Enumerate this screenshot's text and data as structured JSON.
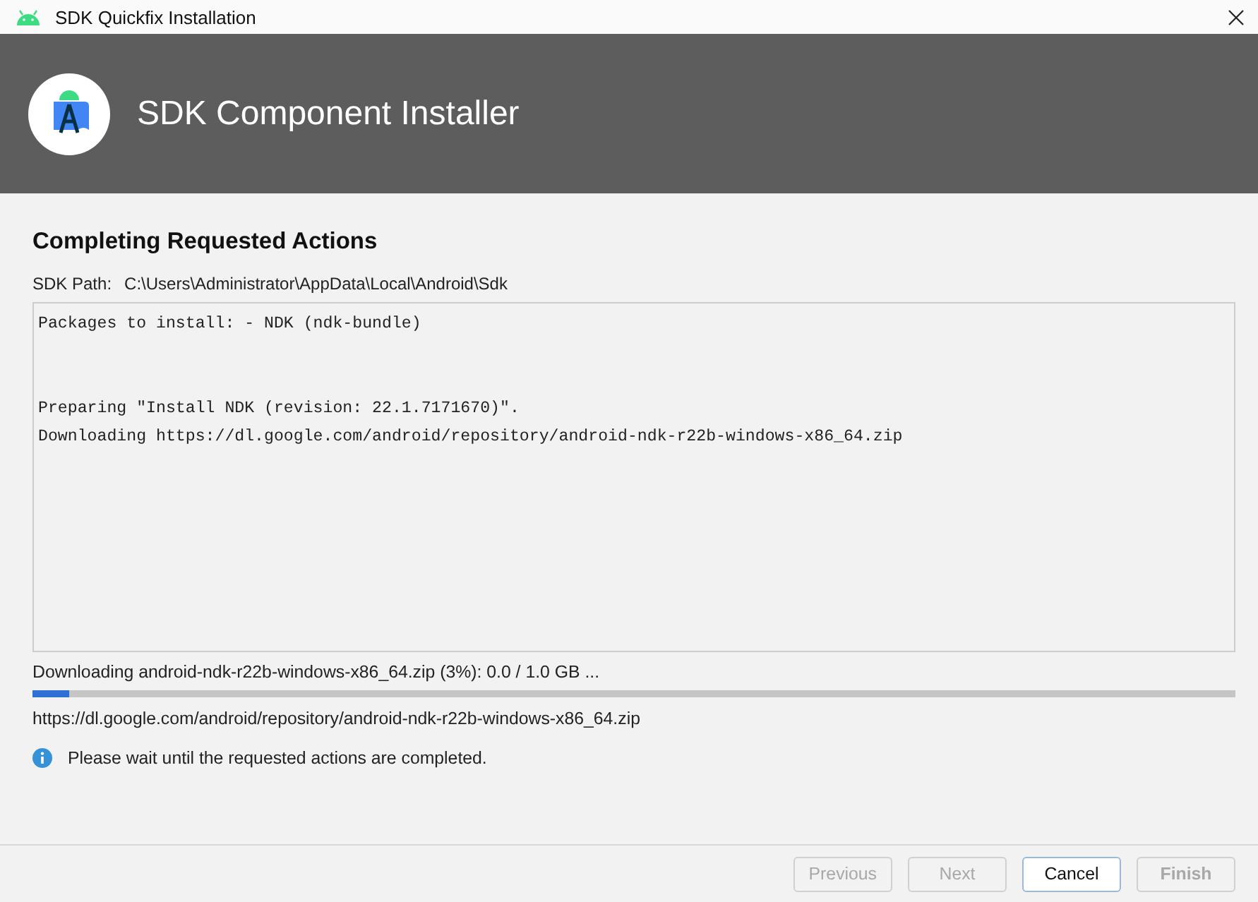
{
  "window": {
    "title": "SDK Quickfix Installation"
  },
  "header": {
    "title": "SDK Component Installer"
  },
  "section_title": "Completing Requested Actions",
  "sdk_path": {
    "label": "SDK Path:",
    "value": "C:\\Users\\Administrator\\AppData\\Local\\Android\\Sdk"
  },
  "log_lines": [
    {
      "kind": "text",
      "text": "Packages to install: - NDK (ndk-bundle)"
    },
    {
      "kind": "blank"
    },
    {
      "kind": "blank"
    },
    {
      "kind": "text",
      "text": "Preparing \"Install NDK (revision: 22.1.7171670)\"."
    },
    {
      "kind": "text",
      "text": "Downloading https://dl.google.com/android/repository/android-ndk-r22b-windows-x86_64.zip"
    }
  ],
  "progress": {
    "label": "Downloading android-ndk-r22b-windows-x86_64.zip (3%): 0.0 / 1.0 GB ...",
    "level": 0.03
  },
  "url": "https://dl.google.com/android/repository/android-ndk-r22b-windows-x86_64.zip",
  "info": "Please wait until the requested actions are completed.",
  "buttons": [
    {
      "label": "Previous",
      "disabled": true,
      "default": false
    },
    {
      "label": "Next",
      "disabled": true,
      "default": false
    },
    {
      "label": "Cancel",
      "disabled": false,
      "default": false
    },
    {
      "label": "Finish",
      "disabled": true,
      "default": true
    }
  ]
}
